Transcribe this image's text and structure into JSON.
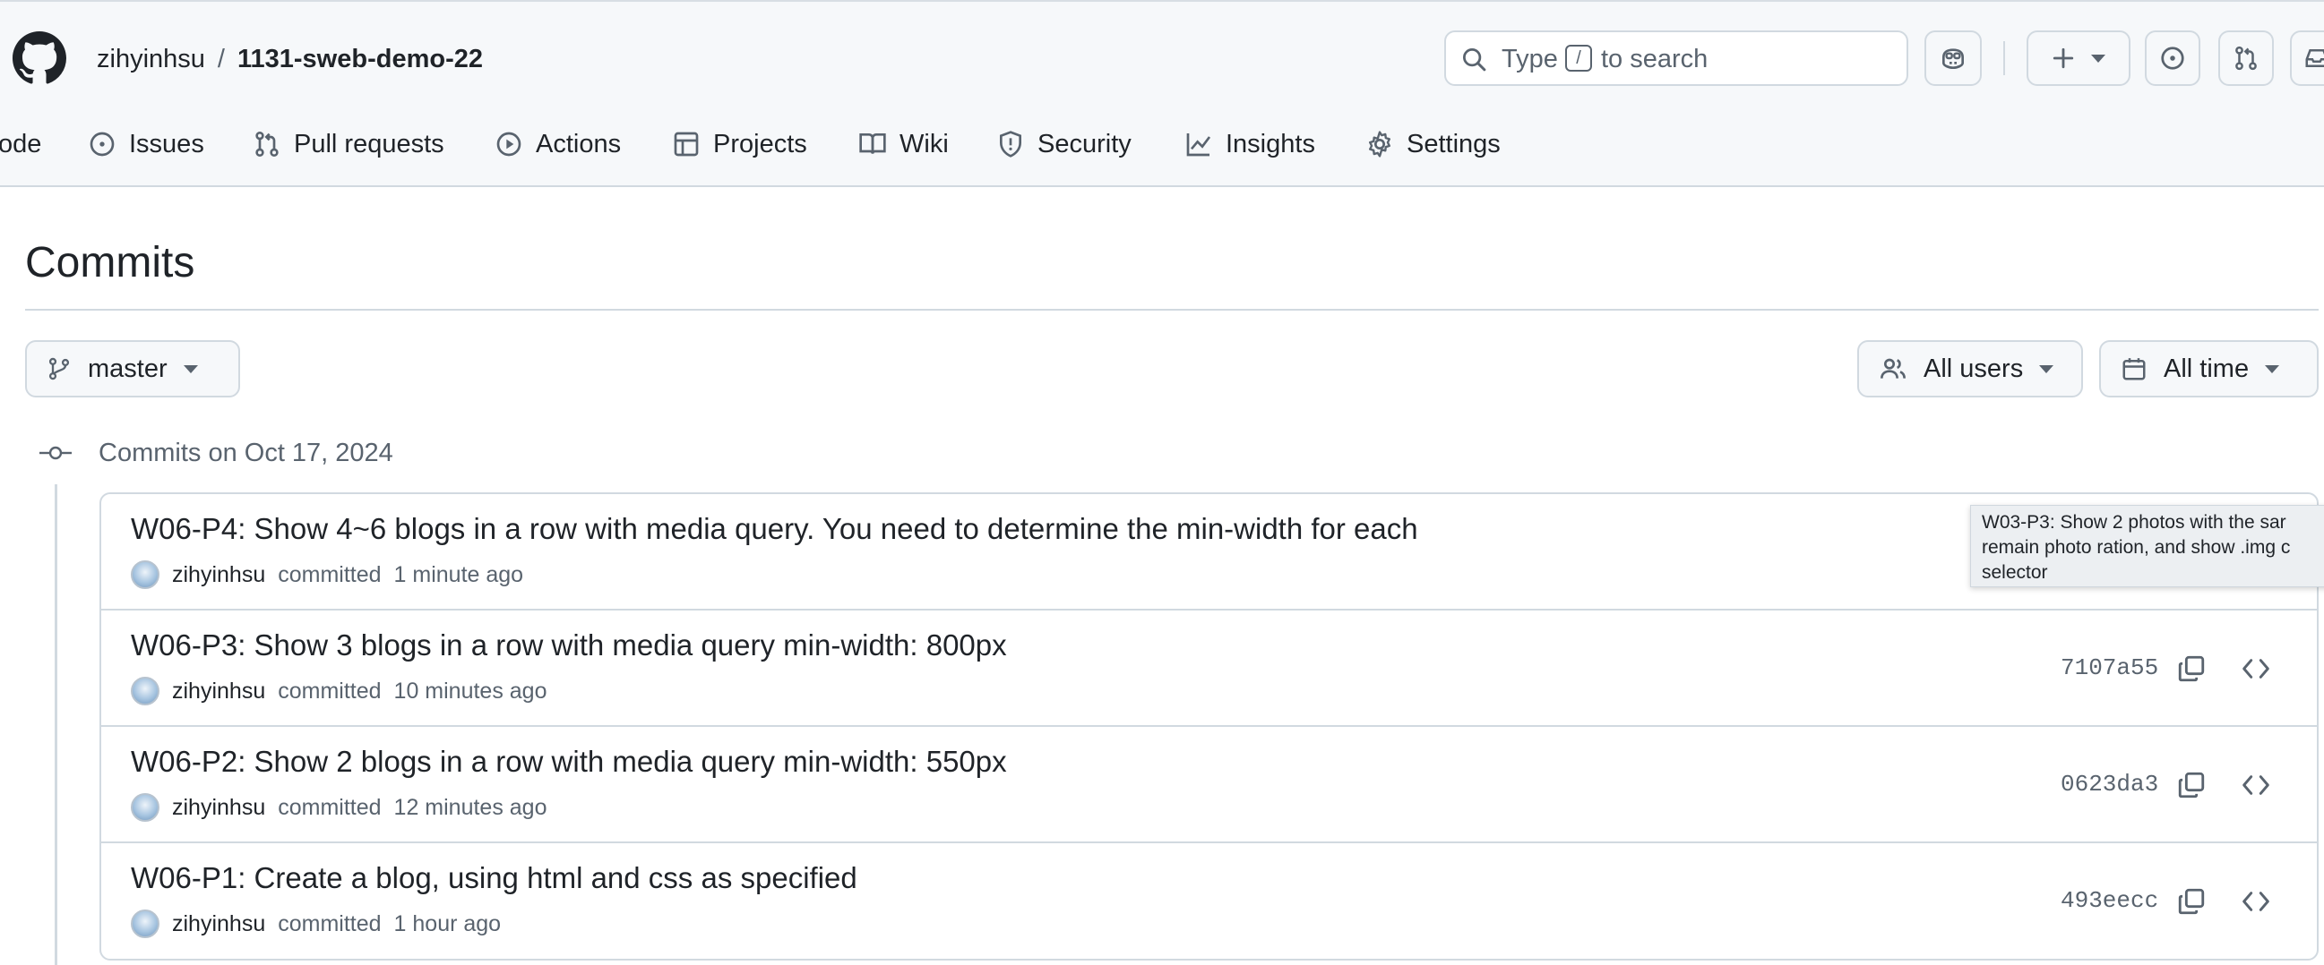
{
  "header": {
    "owner": "zihyinhsu",
    "separator": "/",
    "repo": "1131-sweb-demo-22",
    "search": {
      "prefix": "Type",
      "key": "/",
      "suffix": "to search"
    }
  },
  "tabs": [
    {
      "label": "ode",
      "icon": "code-icon"
    },
    {
      "label": "Issues",
      "icon": "issue-icon"
    },
    {
      "label": "Pull requests",
      "icon": "pull-request-icon"
    },
    {
      "label": "Actions",
      "icon": "play-icon"
    },
    {
      "label": "Projects",
      "icon": "table-icon"
    },
    {
      "label": "Wiki",
      "icon": "book-icon"
    },
    {
      "label": "Security",
      "icon": "shield-icon"
    },
    {
      "label": "Insights",
      "icon": "graph-icon"
    },
    {
      "label": "Settings",
      "icon": "gear-icon"
    }
  ],
  "page": {
    "title": "Commits"
  },
  "filters": {
    "branch": "master",
    "users": "All users",
    "time": "All time"
  },
  "day": {
    "heading": "Commits on Oct 17, 2024"
  },
  "commits": [
    {
      "message": "W06-P4: Show 4~6 blogs in a row with media query. You need to determine the min-width for each",
      "author": "zihyinhsu",
      "action": "committed",
      "time": "1 minute ago",
      "sha": ""
    },
    {
      "message": "W06-P3: Show 3 blogs in a row with media query min-width: 800px",
      "author": "zihyinhsu",
      "action": "committed",
      "time": "10 minutes ago",
      "sha": "7107a55"
    },
    {
      "message": "W06-P2: Show 2 blogs in a row with media query min-width: 550px",
      "author": "zihyinhsu",
      "action": "committed",
      "time": "12 minutes ago",
      "sha": "0623da3"
    },
    {
      "message": "W06-P1: Create a blog, using html and css as specified",
      "author": "zihyinhsu",
      "action": "committed",
      "time": "1 hour ago",
      "sha": "493eecc"
    }
  ],
  "tooltip": {
    "line1": "W03-P3: Show 2 photos with the sar",
    "line2": "remain photo ration, and show .img c",
    "line3": "selector"
  },
  "colors": {
    "text": "#1f2328",
    "muted": "#59636e",
    "border": "#d1d9e0",
    "header_bg": "#f6f8fa"
  }
}
